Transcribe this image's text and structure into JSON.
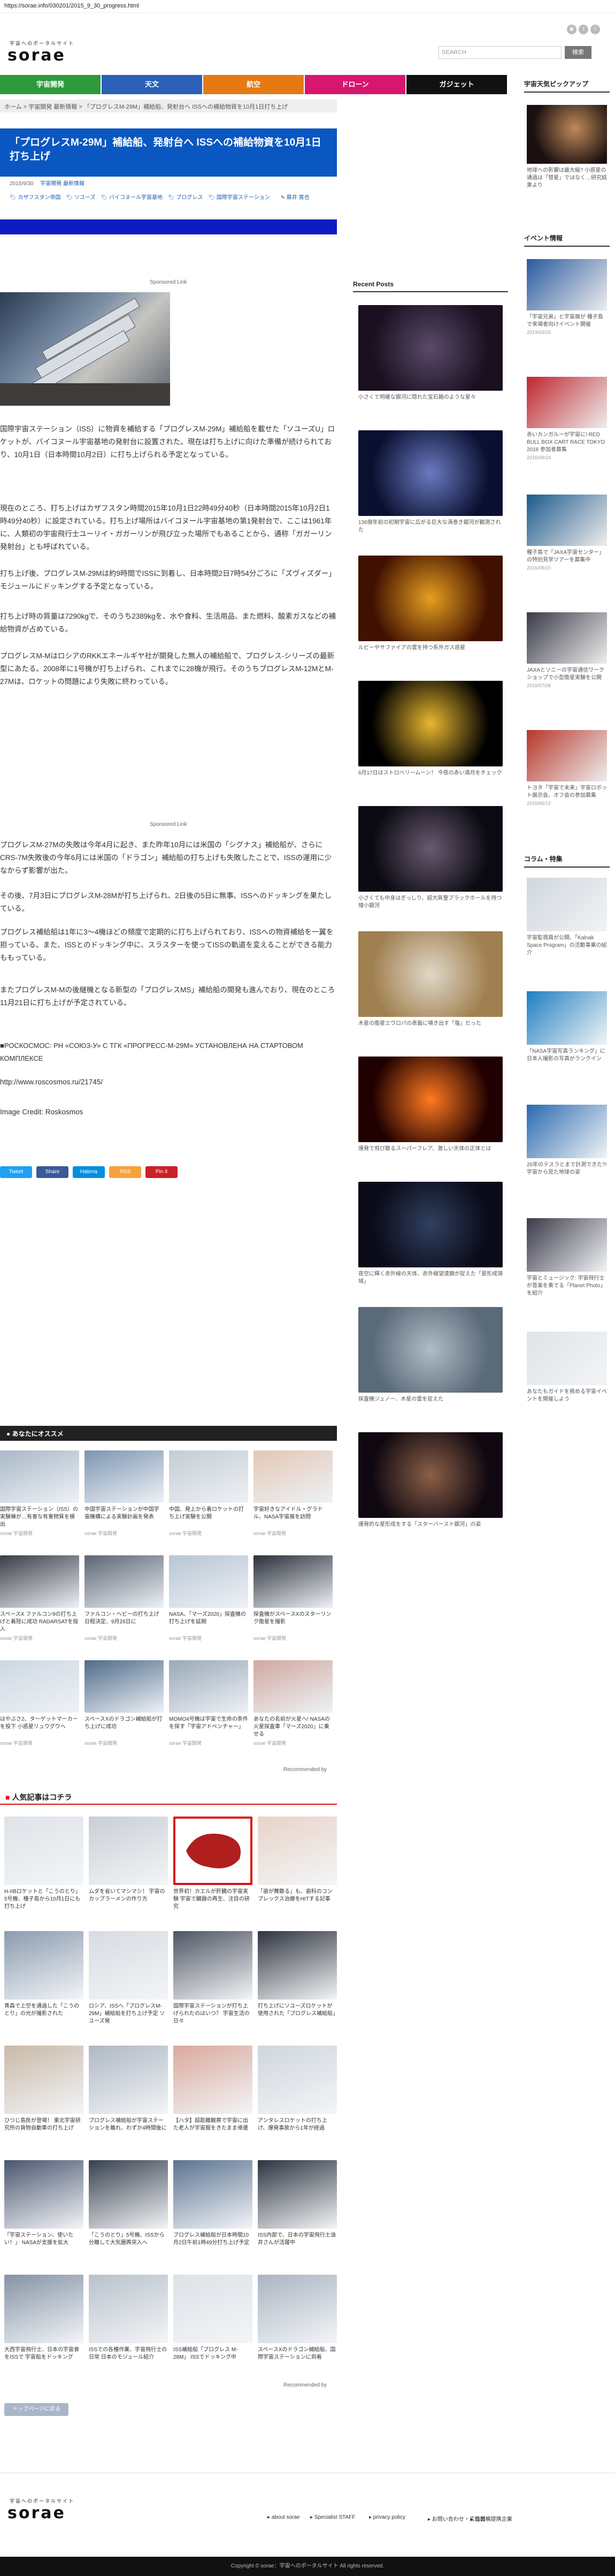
{
  "topbar": {
    "url": "https://sorae.info/030201/2015_9_30_progress.html"
  },
  "header": {
    "logo": "sorae",
    "logo_sub": "宇宙へのポータルサイト",
    "search_placeholder": "SEARCH",
    "search_button": "検索"
  },
  "nav": {
    "items": [
      {
        "label": "宇宙開発",
        "color": "#2d9a3c"
      },
      {
        "label": "天文",
        "color": "#2b5fb8"
      },
      {
        "label": "航空",
        "color": "#e57a14"
      },
      {
        "label": "ドローン",
        "color": "#d7176f"
      },
      {
        "label": "ガジェット",
        "color": "#111111"
      }
    ]
  },
  "breadcrumb": {
    "home": "ホーム",
    "crumb1": "宇宙開発 最新情報",
    "crumb2": "「プログレスM-29M」補給船、発射台へ ISSへの補給物資を10月1日打ち上げ"
  },
  "article": {
    "title": "「プログレスM-29M」補給船、発射台へ ISSへの補給物資を10月1日打ち上げ",
    "date": "2015/9/30",
    "cat1": "宇宙開発",
    "cat2": "最新情報",
    "tags": [
      "カザフスタン帝国",
      "ソユーズ",
      "バイコヌール宇宙基地",
      "プログレス",
      "国際宇宙ステーション"
    ],
    "author": "藤井 寛也",
    "sponsored": "Sponsored Link",
    "paragraphs": [
      "国際宇宙ステーション（ISS）に物資を補給する「プログレスM-29M」補給船を載せた「ソユーズU」ロケットが、バイコヌール宇宙基地の発射台に設置された。現在は打ち上げに向けた準備が続けられており、10月1日（日本時間10月2日）に打ち上げられる予定となっている。",
      "現在のところ、打ち上げはカザフスタン時間2015年10月1日22時49分40秒（日本時間2015年10月2日1時49分40秒）に設定されている。打ち上げ場所はバイコヌール宇宙基地の第1発射台で、ここは1961年に、人類初の宇宙飛行士ユーリイ・ガガーリンが飛び立った場所でもあることから、通称「ガガーリン発射台」とも呼ばれている。",
      "打ち上げ後、プログレスM-29Mは約9時間でISSに到着し、日本時間2日7時54分ごろに「ズヴィズダー」モジュールにドッキングする予定となっている。",
      "打ち上げ時の質量は7290kgで、そのうち2389kgを、水や食料、生活用品、また燃料、酸素ガスなどの補給物資が占めている。",
      "プログレスM-MはロシアのRKKエネールギヤ社が開発した無人の補給船で、プログレス-シリーズの最新型にあたる。2008年に1号機が打ち上げられ、これまでに28機が飛行。そのうちプログレスM-12MとM-27Mは、ロケットの問題により失敗に終わっている。",
      "プログレスM-27Mの失敗は今年4月に起き、また昨年10月には米国の「シグナス」補給船が、さらにCRS-7M失敗後の今年6月には米国の「ドラゴン」補給船の打ち上げも失敗したことで、ISSの運用に少なからず影響が出た。",
      "その後、7月3日にプログレスM-28Mが打ち上げられ、2日後の5日に無事、ISSへのドッキングを果たしている。",
      "プログレス補給船は1年に3～4機ほどの頻度で定期的に打ち上げられており、ISSへの物資補給を一翼を担っている。また、ISSとのドッキング中に、スラスターを使ってISSの軌道を変えることができる能力ももっている。",
      "またプログレスM-Mの後継機となる新型の「プログレスMS」補給船の開発も進んでおり、現在のところ11月21日に打ち上げが予定されている。"
    ],
    "source_line": "■РОСКОСМОС: РН «СОЮЗ-У» С ТГК «ПРОГРЕСС-М-29М» УСТАНОВЛЕНА НА СТАРТОВОМ КОМПЛЕКСЕ",
    "source_url": "http://www.roscosmos.ru/21745/",
    "credit": "Image Credit: Roskosmos",
    "share": [
      {
        "label": "Tweet",
        "color": "#1da1f2"
      },
      {
        "label": "Share",
        "color": "#3b5998"
      },
      {
        "label": "Hatena",
        "color": "#008fde"
      },
      {
        "label": "RSS",
        "color": "#f7a13b"
      },
      {
        "label": "Pin it",
        "color": "#cb2027"
      }
    ]
  },
  "recommend": {
    "title": "あなたにオススメ",
    "items": [
      {
        "caption": "国際宇宙ステーション（ISS）の実験棟が…有害な有害物質を検出",
        "src": "sorae 宇宙開発"
      },
      {
        "caption": "中国宇宙ステーションが中国宇宙機構による実験計画を発表",
        "src": "sorae 宇宙開発"
      },
      {
        "caption": "中国、発上から着ロケットの打ち上げ実験を公開",
        "src": "sorae 宇宙開発"
      },
      {
        "caption": "宇宙好きなアイドル・グラドル、NASA宇宙展を訪問",
        "src": "sorae 宇宙開発"
      },
      {
        "caption": "スペースX ファルコン9の打ち上げと着陸に成功 RADARSATを投入",
        "src": "sorae 宇宙開発"
      },
      {
        "caption": "ファルコン・ヘビーの打ち上げ日程決定、9月26日に",
        "src": "sorae 宇宙開発"
      },
      {
        "caption": "NASA、「マーズ2020」探査機の打ち上げを延期",
        "src": "sorae 宇宙開発"
      },
      {
        "caption": "探査機がスペースXのスターリンク衛星を撮影",
        "src": "sorae 宇宙開発"
      },
      {
        "caption": "はやぶさ2、ターゲットマーカーを投下 小惑星リュウグウへ",
        "src": "sorae 宇宙開発"
      },
      {
        "caption": "スペースXのドラゴン補給船が打ち上げに成功",
        "src": "sorae 宇宙開発"
      },
      {
        "caption": "MOMO4号機は宇宙で生命の条件を探す「宇宙アドベンチャー」",
        "src": "sorae 宇宙開発"
      },
      {
        "caption": "あなたの名前が火星へ! NASAの火星探査車「マーズ2020」に乗せる",
        "src": "sorae 宇宙開発"
      }
    ],
    "recommended_by": "Recommended by"
  },
  "popular": {
    "title": "人気記事はコチラ",
    "items": [
      {
        "caption": "H-IIBロケットと「こうのとり」5号機、種子島から10月1日にも打ち上げ"
      },
      {
        "caption": "ムダを省いてマシマシ！ 宇宙のカップラーメンの作り方"
      },
      {
        "caption": "世界初！カエルが肝臓の宇宙実験 宇宙で臓器の再生、注目の研究"
      },
      {
        "caption": "「歯が舞散る」も、歯科のコンプレックス治療をHITする記事"
      },
      {
        "caption": "青森で上空を通過した「こうのとり」の光が撮影された"
      },
      {
        "caption": "ロシア、ISSへ「プログレスM-29M」補給船を打ち上げ予定 ソユーズ発"
      },
      {
        "caption": "国際宇宙ステーションが打ち上げられたのはいつ？ 宇宙生活の日々"
      },
      {
        "caption": "打ち上げにソユーズロケットが使用された「プログレス補給船」"
      },
      {
        "caption": "ひつじ島民が登場！ 東北宇宙研究所の貨物自動車の打ち上げ"
      },
      {
        "caption": "プログレス補給船が宇宙ステーションを離れ、わずか4時間後に"
      },
      {
        "caption": "【ハタ】超距離観察で宇宙に出た老人が宇宙服をきたまま帰還"
      },
      {
        "caption": "アンタレスロケットの打ち上げ、爆発事故から1年が経過"
      },
      {
        "caption": "「宇宙ステーション、使いたい！」 NASAが支援を拡大"
      },
      {
        "caption": "「こうのとり」5号機、ISSから分離して大気圏再突入へ"
      },
      {
        "caption": "プログレス補給船が日本時間10月2日午前1時49分打ち上げ予定"
      },
      {
        "caption": "ISS内部で、日本の宇宙飛行士油井さんが活躍中"
      },
      {
        "caption": "大西宇宙飛行士、日本の宇宙食をISSで 宇宙船をドッキング"
      },
      {
        "caption": "ISSでの各種作業、宇宙飛行士の日常 日本のモジュール紹介"
      },
      {
        "caption": "ISS補給船「プログレス M-28M」 ISSでドッキング中"
      },
      {
        "caption": "スペースXのドラゴン補給船、国際宇宙ステーションに到着"
      }
    ],
    "recommended_by": "Recommended by",
    "topics_button": "トップページに戻る"
  },
  "sidebar": {
    "recent_title": "Recent Posts",
    "recent": [
      {
        "caption": "小さくて明確な銀河に隠れた宝石箱のような星々"
      },
      {
        "caption": "136億年前の初期宇宙に広がる巨大な渦巻き銀河が観測された"
      },
      {
        "caption": "ルビーやサファイアの雲を持つ系外ガス惑星"
      },
      {
        "caption": "6月17日はストロベリームーン！ 今夜の赤い満月をチェック"
      },
      {
        "caption": "小さくても中身はぎっしり、超大質量ブラックホールを持つ矮小銀河"
      },
      {
        "caption": "木星の衛星エウロパの表面に噴き出す「塩」だった"
      },
      {
        "caption": "爆発で飛び散るスーパーフレア、激しい天体の正体とは"
      },
      {
        "caption": "夜空に輝く赤外線の天体、赤外線望遠鏡が捉えた「星形成領域」"
      },
      {
        "caption": "探査機ジュノー、木星の雲を捉えた"
      },
      {
        "caption": "爆発的な星形成をする「スターバースト銀河」の姿"
      }
    ],
    "right_title1": "宇宙天気ピックアップ",
    "right_items1": [
      {
        "caption": "地球への影響は最大級? 小惑星の通過は「彗星」ではなく…研究結果より"
      }
    ],
    "right_title2": "イベント情報",
    "right_items2": [
      {
        "caption": "「宇宙兄弟」と宇宙展が 種子島で来場者向けイベント開催",
        "date": "2019/03/29"
      },
      {
        "caption": "赤いカンガルーが宇宙に! RED BULL BOX CART RACE TOKYO 2016 参加者募集",
        "date": "2016/08/24"
      },
      {
        "caption": "種子島で「JAXA宇宙センター」の特別見学ツアーを募集中",
        "date": "2016/08/15"
      },
      {
        "caption": "JAXAとソニーの宇宙通信ワークショップで小型衛星実験を公開",
        "date": "2016/07/08"
      },
      {
        "caption": "トヨタ「宇宙で未来」宇宙ロボット展示会、オフ会の参加募集",
        "date": "2016/06/12"
      }
    ],
    "right_title3": "コラム・特集",
    "right_items3": [
      {
        "caption": "宇宙監視員が公開、「Kalnak Space Program」の活動事業の紹介",
        "date": ""
      },
      {
        "caption": "「NASA宇宙写真ランキング」に日本人撮影の写真がランクイン",
        "date": ""
      },
      {
        "caption": "26年のテスラとまで計測できた?! 宇宙から見た地球の姿",
        "date": ""
      },
      {
        "caption": "宇宙とミュージック: 宇宙飛行士が音楽を奏でる「Planet Photo」を紹介",
        "date": ""
      },
      {
        "caption": "あなたもガイドを務める宇宙イベントを開催しよう",
        "date": ""
      }
    ]
  },
  "footer": {
    "logo": "sorae",
    "logo_sub": "宇宙へのポータルサイト",
    "links": [
      "about sorae",
      "Specialist STAFF",
      "privacy policy",
      "お問い合わせ・広告出稿",
      "協賛・提携企業"
    ],
    "copyright": "Copyright © sorae：宇宙へのポータルサイト All rights reserved."
  }
}
